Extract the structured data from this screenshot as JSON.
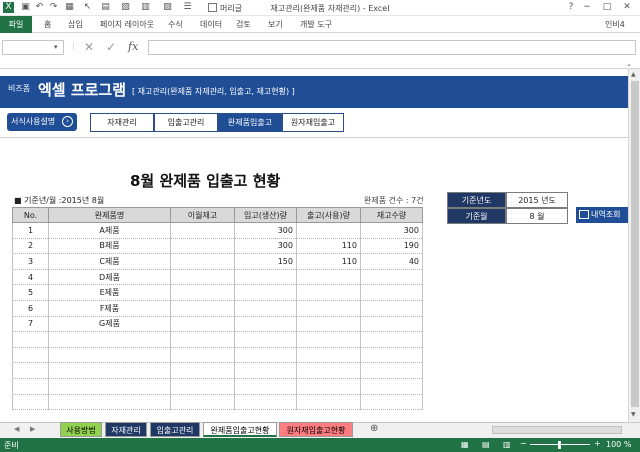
{
  "titlebar": {
    "title": "재고관리(완제품 자재관리) - Excel",
    "checkbox_label": "머리글",
    "minimize": "−",
    "maximize": "□",
    "close": "✕"
  },
  "ribbon": {
    "tabs": [
      "파일",
      "홈",
      "삽입",
      "페이지 레이아웃",
      "수식",
      "데이터",
      "검토",
      "보기",
      "개발 도구"
    ],
    "user": "인비4"
  },
  "formula_bar": {
    "namebox": "",
    "fx": "fx",
    "value": ""
  },
  "banner": {
    "logo_small": "비즈폼",
    "logo_big": "엑셀 프로그램",
    "subtitle": "[ 재고관리(완제품 자재관리, 입출고, 재고현황) ]"
  },
  "nav": {
    "help": "서식사용설명",
    "buttons": [
      "자재관리",
      "입출고관리",
      "완제품입출고",
      "원자재입출고"
    ],
    "active_index": 2
  },
  "report": {
    "title": "8월 완제품 입출고 현황",
    "base_label": "■ 기준년/월 :2015년 8월",
    "count_label": "완제품 건수 : 7건"
  },
  "table": {
    "headers": [
      "No.",
      "완제품명",
      "이월재고",
      "입고(생산)량",
      "출고(사용)량",
      "재고수량"
    ],
    "rows": [
      [
        "1",
        "A제품",
        "",
        "300",
        "",
        "300"
      ],
      [
        "2",
        "B제품",
        "",
        "300",
        "110",
        "190"
      ],
      [
        "3",
        "C제품",
        "",
        "150",
        "110",
        "40"
      ],
      [
        "4",
        "D제품",
        "",
        "",
        "",
        ""
      ],
      [
        "5",
        "E제품",
        "",
        "",
        "",
        ""
      ],
      [
        "6",
        "F제품",
        "",
        "",
        "",
        ""
      ],
      [
        "7",
        "G제품",
        "",
        "",
        "",
        ""
      ]
    ]
  },
  "side": {
    "year_label": "기준년도",
    "year_value": "2015 년도",
    "month_label": "기준월",
    "month_value": "8 월",
    "detail_button": "내역조회"
  },
  "sheet_tabs": {
    "tabs": [
      {
        "label": "사용방법",
        "color": "#92d050",
        "text": "#000000"
      },
      {
        "label": "자재관리",
        "color": "#1f3864",
        "text": "#ffffff"
      },
      {
        "label": "입출고관리",
        "color": "#1f3864",
        "text": "#ffffff"
      },
      {
        "label": "완제품입출고현황",
        "color": "#ffffff",
        "text": "#000000"
      },
      {
        "label": "원자재입출고현황",
        "color": "#ff7c80",
        "text": "#000000"
      }
    ],
    "add": "⊕"
  },
  "status": {
    "left": "준비",
    "zoom": "100 %"
  },
  "colors": {
    "excel_green": "#217346",
    "banner_blue": "#1f4e96"
  }
}
